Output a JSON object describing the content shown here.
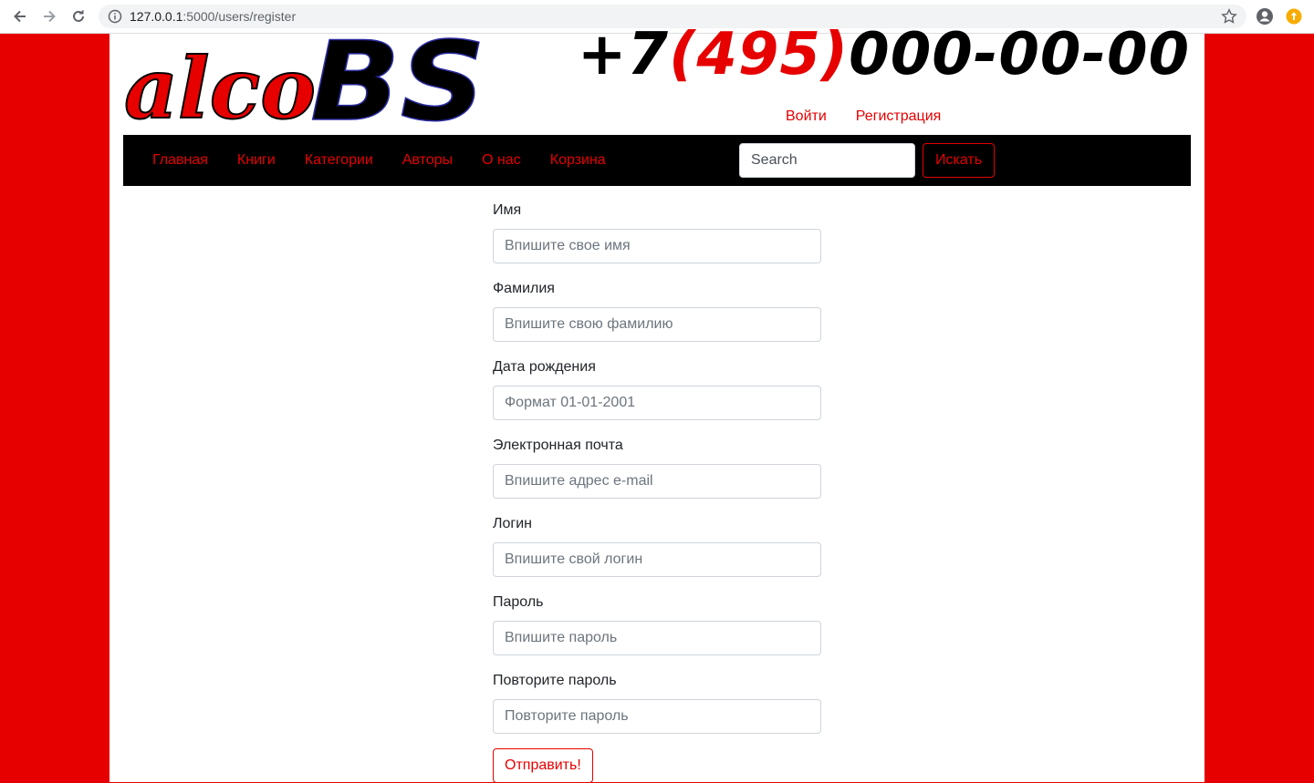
{
  "browser": {
    "url_host": "127.0.0.1",
    "url_rest": ":5000/users/register"
  },
  "header": {
    "logo_part1": "alco",
    "logo_part2": "BS",
    "phone_prefix": "+7",
    "phone_area": "(495)",
    "phone_number": "000-00-00",
    "login_link": "Войти",
    "register_link": "Регистрация"
  },
  "nav": {
    "items": [
      "Главная",
      "Книги",
      "Категории",
      "Авторы",
      "О нас",
      "Корзина"
    ],
    "search_placeholder": "Search",
    "search_button": "Искать"
  },
  "form": {
    "fields": [
      {
        "label": "Имя",
        "placeholder": "Впишите свое имя"
      },
      {
        "label": "Фамилия",
        "placeholder": "Впишите свою фамилию"
      },
      {
        "label": "Дата рождения",
        "placeholder": "Формат 01-01-2001"
      },
      {
        "label": "Электронная почта",
        "placeholder": "Впишите адрес e-mail"
      },
      {
        "label": "Логин",
        "placeholder": "Впишите свой логин"
      },
      {
        "label": "Пароль",
        "placeholder": "Впишите пароль"
      },
      {
        "label": "Повторите пароль",
        "placeholder": "Повторите пароль"
      }
    ],
    "submit": "Отправить!"
  },
  "colors": {
    "accent": "#e60000",
    "navbar": "#000000"
  }
}
